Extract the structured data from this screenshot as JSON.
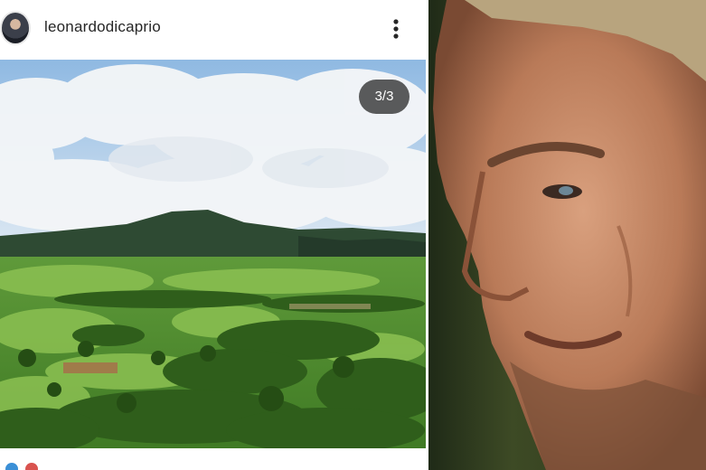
{
  "post": {
    "username": "leonardodicaprio",
    "image_counter": "3/3"
  },
  "icons": {
    "menu": "more-vertical-icon",
    "avatar": "profile-avatar"
  }
}
